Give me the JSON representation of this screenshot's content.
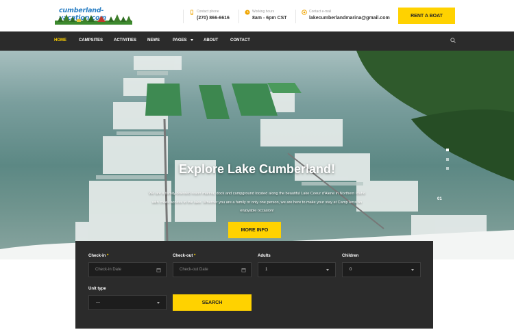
{
  "header": {
    "logo_text": "cumberland-vacation.com",
    "phone": {
      "label": "Contact phone",
      "value": "(270) 866-6616"
    },
    "hours": {
      "label": "Working hours",
      "value": "8am - 6pm CST"
    },
    "email": {
      "label": "Contact e-mail",
      "value": "lakecumberlandmarina@gmail.com"
    },
    "rent_button": "RENT A BOAT"
  },
  "nav": {
    "items": [
      "HOME",
      "CAMPSITES",
      "ACTIVITIES",
      "NEWS",
      "PAGES",
      "ABOUT",
      "CONTACT"
    ],
    "active": "HOME"
  },
  "hero": {
    "title": "Explore Lake Cumberland!",
    "description": "We are a family-oriented resort marina, dock and campground located along the beautiful Lake Coeur d'Alene in Northern Idaho with creek access to the lake. Whether you are a family or only one person, we are here to make your stay at CampTerra an enjoyable occasion!",
    "button": "MORE INFO",
    "slide_number": "01"
  },
  "booking": {
    "checkin": {
      "label": "Check-in",
      "required": "*",
      "placeholder": "Check-in Date"
    },
    "checkout": {
      "label": "Check-out",
      "required": "*",
      "placeholder": "Check-out Date"
    },
    "adults": {
      "label": "Adults",
      "value": "1"
    },
    "children": {
      "label": "Children",
      "value": "0"
    },
    "unit_type": {
      "label": "Unit type",
      "value": "—"
    },
    "search_button": "SEARCH"
  },
  "colors": {
    "accent": "#ffd200",
    "dark": "#2b2b2b"
  }
}
